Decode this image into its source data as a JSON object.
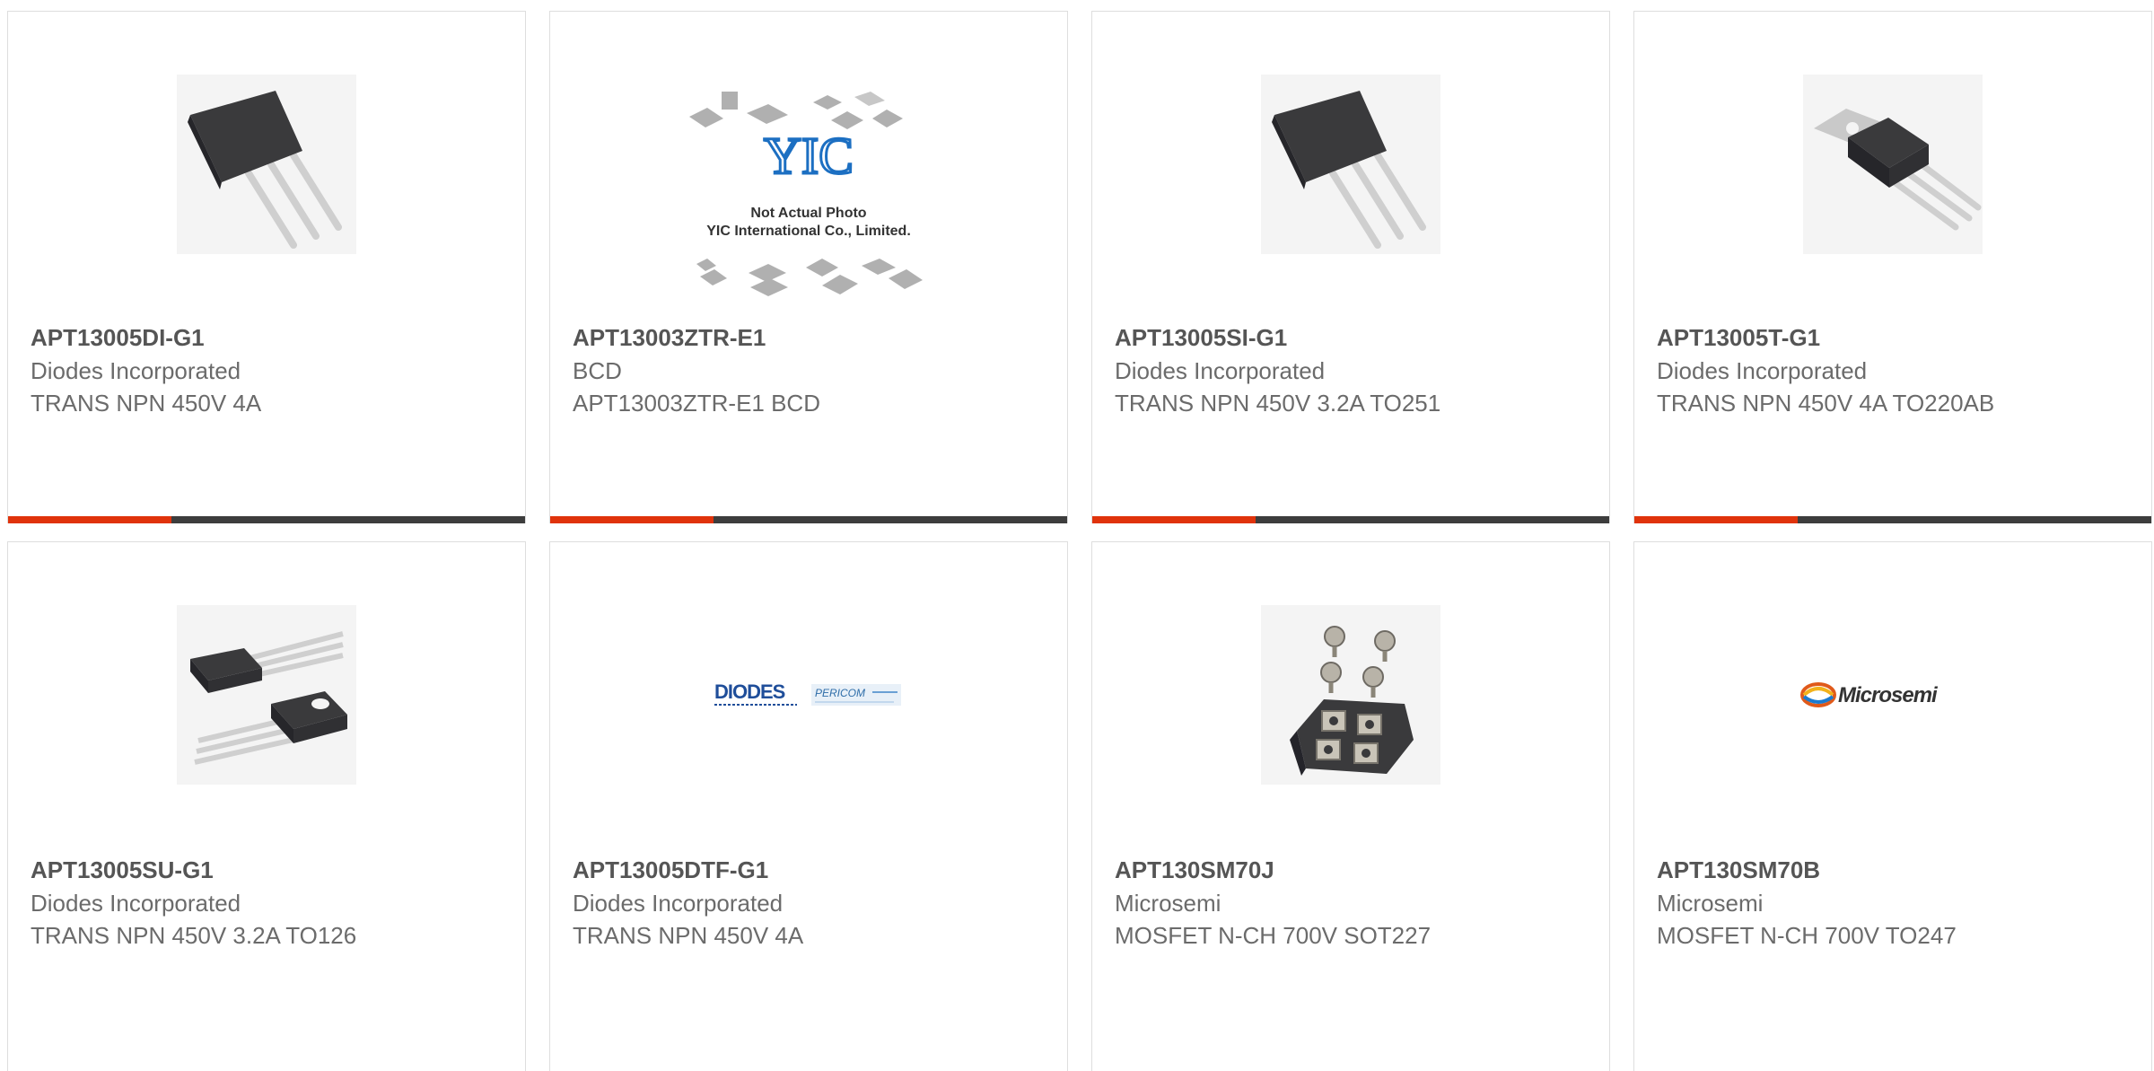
{
  "products": [
    {
      "part": "APT13005DI-G1",
      "manufacturer": "Diodes Incorporated",
      "description": "TRANS NPN 450V 4A",
      "image_icon": "to251-transistor-icon"
    },
    {
      "part": "APT13003ZTR-E1",
      "manufacturer": "BCD",
      "description": "APT13003ZTR-E1 BCD",
      "image_icon": "placeholder-not-actual-photo-icon",
      "placeholder_text": [
        "Not Actual Photo",
        "YIC International Co., Limited."
      ],
      "placeholder_logo": "YIC"
    },
    {
      "part": "APT13005SI-G1",
      "manufacturer": "Diodes Incorporated",
      "description": "TRANS NPN 450V 3.2A TO251",
      "image_icon": "to251-transistor-icon"
    },
    {
      "part": "APT13005T-G1",
      "manufacturer": "Diodes Incorporated",
      "description": "TRANS NPN 450V 4A TO220AB",
      "image_icon": "to220-transistor-icon"
    },
    {
      "part": "APT13005SU-G1",
      "manufacturer": "Diodes Incorporated",
      "description": "TRANS NPN 450V 3.2A TO126",
      "image_icon": "to126-transistor-icon"
    },
    {
      "part": "APT13005DTF-G1",
      "manufacturer": "Diodes Incorporated",
      "description": "TRANS NPN 450V 4A",
      "image_icon": "diodes-pericom-logo-icon",
      "logo_text": [
        "DIODES",
        "PERICOM"
      ]
    },
    {
      "part": "APT130SM70J",
      "manufacturer": "Microsemi",
      "description": "MOSFET N-CH 700V SOT227",
      "image_icon": "sot227-module-icon"
    },
    {
      "part": "APT130SM70B",
      "manufacturer": "Microsemi",
      "description": "MOSFET N-CH 700V TO247",
      "image_icon": "microsemi-logo-icon",
      "logo_text": [
        "Microsemi"
      ]
    }
  ],
  "colors": {
    "accent": "#e0330b",
    "bar": "#3d3d3d",
    "border": "#dedede",
    "part_text": "#555555",
    "sub_text": "#6b6b6b"
  }
}
